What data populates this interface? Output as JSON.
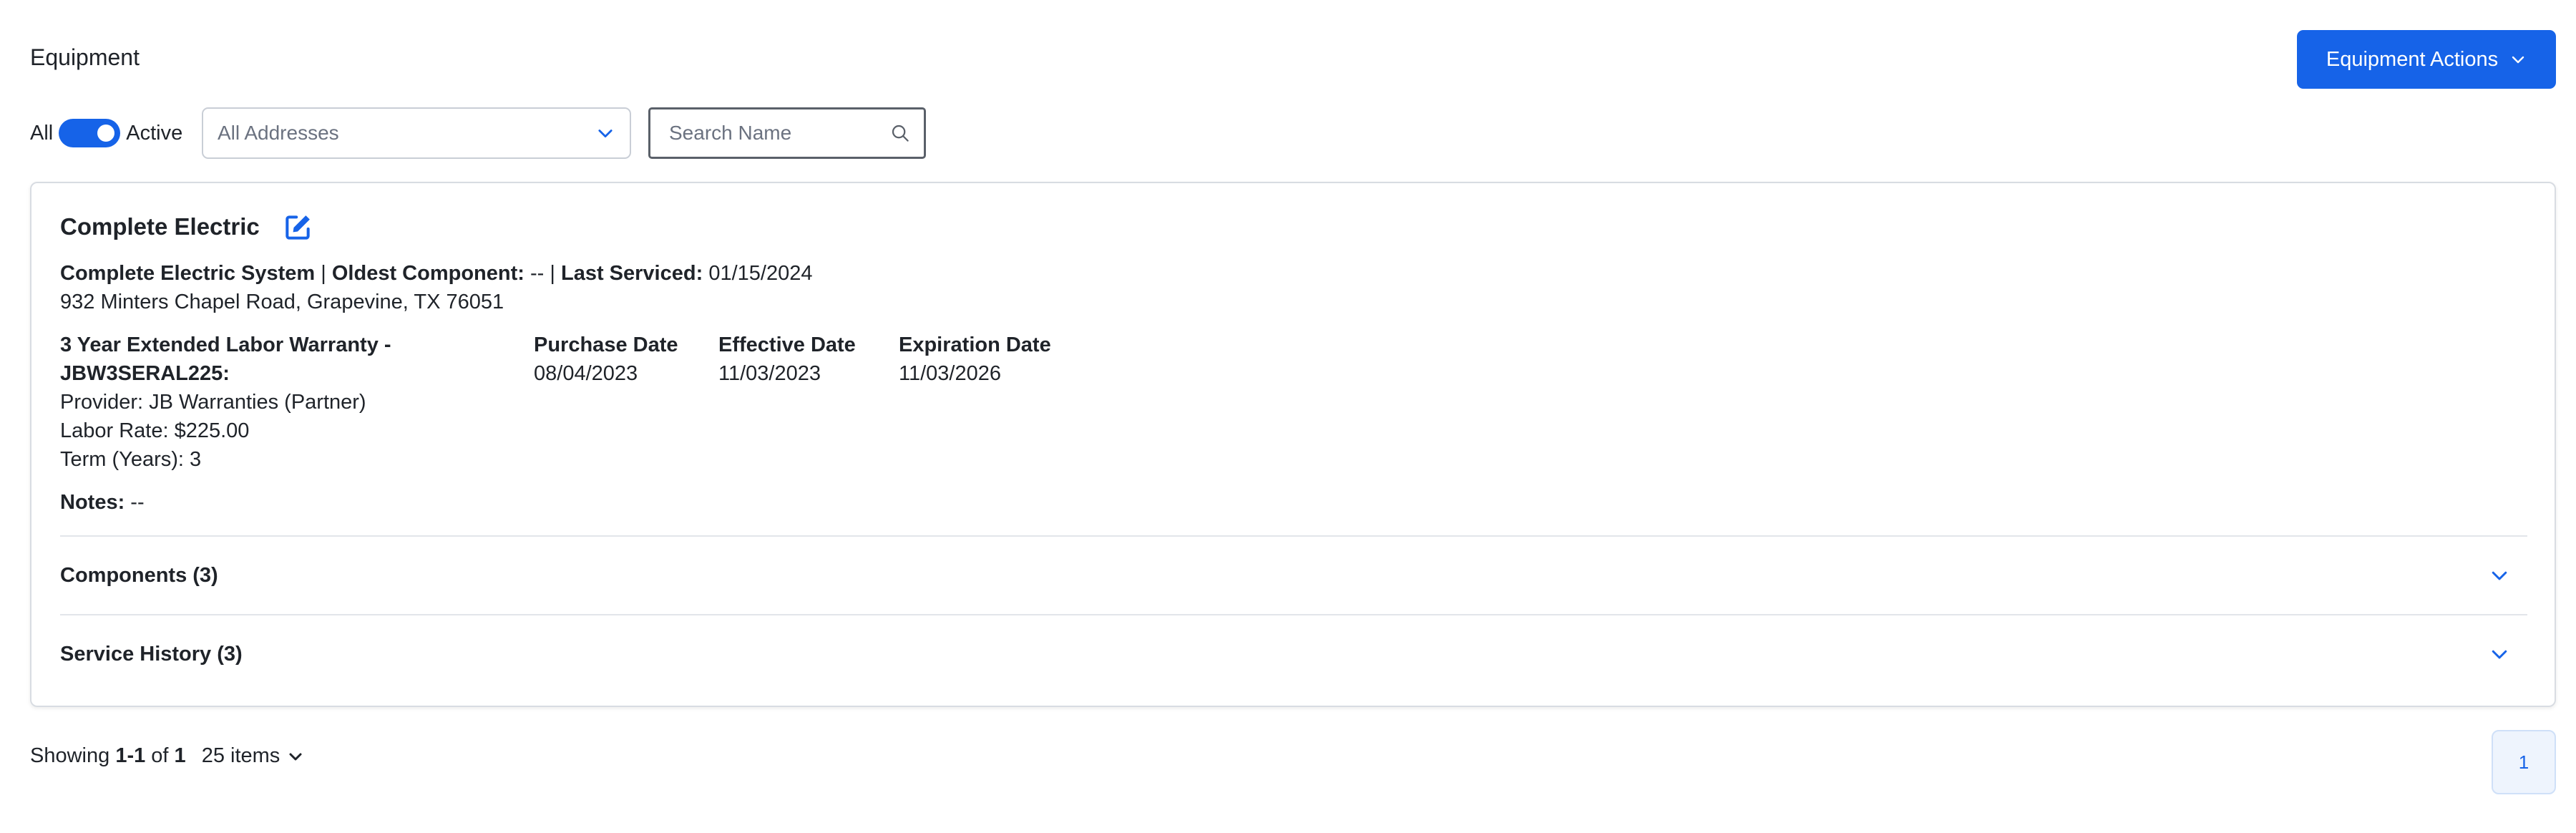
{
  "header": {
    "title": "Equipment",
    "actions_label": "Equipment Actions"
  },
  "filters": {
    "toggle_left": "All",
    "toggle_right": "Active",
    "address_select": "All Addresses",
    "search_placeholder": "Search Name"
  },
  "card": {
    "title": "Complete Electric",
    "summary": {
      "system": "Complete Electric System",
      "sep": "|",
      "oldest_label": "Oldest Component:",
      "oldest_value": "--",
      "serviced_label": "Last Serviced:",
      "serviced_value": "01/15/2024"
    },
    "address": "932 Minters Chapel Road, Grapevine, TX 76051",
    "warranty": {
      "title": "3 Year Extended Labor Warranty - JBW3SERAL225:",
      "provider": "Provider: JB Warranties (Partner)",
      "labor_rate": "Labor Rate: $225.00",
      "term": "Term (Years): 3"
    },
    "dates": [
      {
        "label": "Purchase Date",
        "value": "08/04/2023"
      },
      {
        "label": "Effective Date",
        "value": "11/03/2023"
      },
      {
        "label": "Expiration Date",
        "value": "11/03/2026"
      }
    ],
    "notes_label": "Notes:",
    "notes_value": "--",
    "sections": [
      {
        "label": "Components (3)"
      },
      {
        "label": "Service History (3)"
      }
    ]
  },
  "footer": {
    "showing_prefix": "Showing",
    "range": "1-1",
    "of": "of",
    "total": "1",
    "per_page": "25 items",
    "current_page": "1"
  },
  "colors": {
    "accent": "#1663e8",
    "border": "#d8dce2",
    "text": "#1f2329",
    "muted": "#6b7280"
  }
}
